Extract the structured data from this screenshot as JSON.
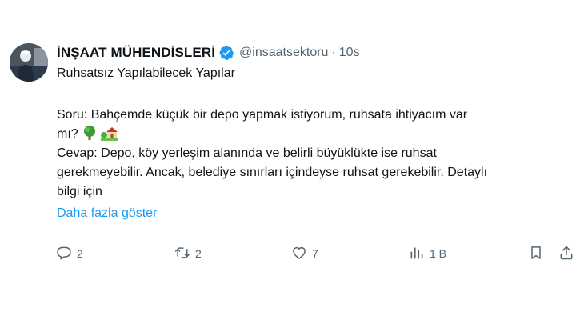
{
  "tweet": {
    "author_name": "İNŞAAT MÜHENDİSLERİ",
    "handle": "@insaatsektoru",
    "separator": "·",
    "time": "10s",
    "title": "Ruhsatsız Yapılabilecek Yapılar",
    "lines": [
      "Soru: Bahçemde küçük bir depo yapmak istiyorum, ruhsata ihtiyacım var",
      "mı?",
      "Cevap:  Depo, köy yerleşim alanında ve belirli büyüklükte ise ruhsat",
      "gerekmeyebilir. Ancak, belediye sınırları içindeyse ruhsat gerekebilir. Detaylı",
      "bilgi için"
    ],
    "show_more": "Daha fazla göster",
    "emojis": [
      "tree-emoji",
      "house-with-garden-emoji"
    ]
  },
  "actions": {
    "replies": "2",
    "reposts": "2",
    "likes": "7",
    "views": "1 B"
  },
  "icons": {
    "verified": "verified-badge-icon",
    "reply": "reply-icon",
    "repost": "repost-icon",
    "like": "heart-icon",
    "views": "views-chart-icon",
    "bookmark": "bookmark-icon",
    "share": "share-icon"
  },
  "colors": {
    "text": "#0f1419",
    "secondary": "#536471",
    "link": "#1d9bf0"
  }
}
